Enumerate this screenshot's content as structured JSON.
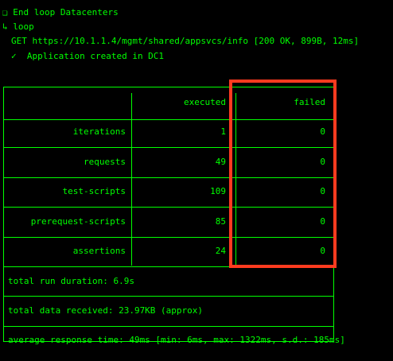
{
  "log": {
    "end_loop": "❑ End loop Datacenters",
    "loop": "↳ loop",
    "request": "GET https://10.1.1.4/mgmt/shared/appsvcs/info [200 OK, 899B, 12ms]",
    "check": "✓  Application created in DC1"
  },
  "table": {
    "headers": {
      "executed": "executed",
      "failed": "failed"
    },
    "rows": [
      {
        "label": "iterations",
        "executed": "1",
        "failed": "0"
      },
      {
        "label": "requests",
        "executed": "49",
        "failed": "0"
      },
      {
        "label": "test-scripts",
        "executed": "109",
        "failed": "0"
      },
      {
        "label": "prerequest-scripts",
        "executed": "85",
        "failed": "0"
      },
      {
        "label": "assertions",
        "executed": "24",
        "failed": "0"
      }
    ],
    "summary": {
      "duration": "total run duration: 6.9s",
      "data": "total data received: 23.97KB (approx)",
      "response": "average response time: 49ms [min: 6ms, max: 1322ms, s.d.: 185ms]"
    }
  },
  "colors": {
    "text": "#00ff00",
    "background": "#000000",
    "highlight": "#ff3b1f"
  }
}
